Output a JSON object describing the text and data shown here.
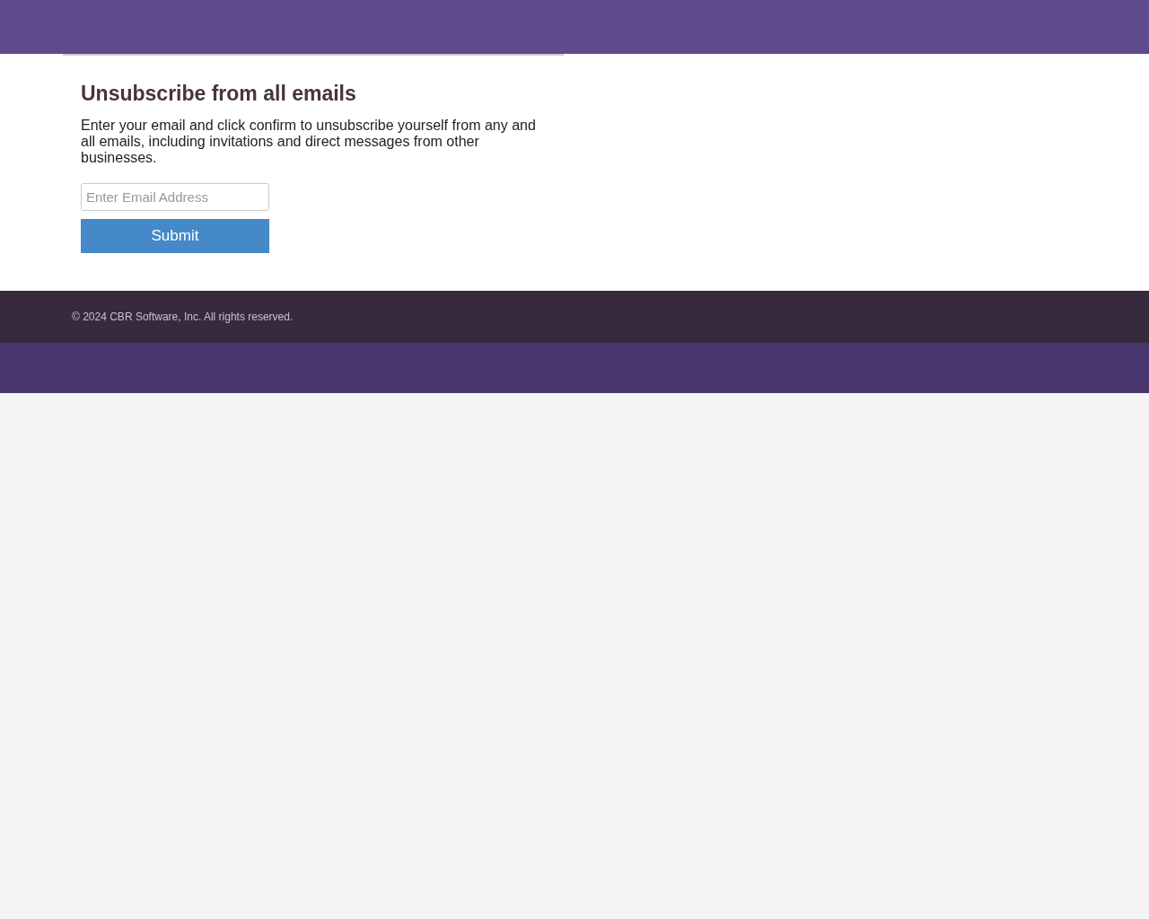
{
  "form": {
    "title": "Unsubscribe from all emails",
    "description": "Enter your email and click confirm to unsubscribe yourself from any and all emails, including invitations and direct messages from other businesses.",
    "email": {
      "placeholder": "Enter Email Address"
    },
    "submit": "Submit"
  },
  "footer": {
    "copyright": "© 2024 CBR Software, Inc. All rights reserved."
  }
}
